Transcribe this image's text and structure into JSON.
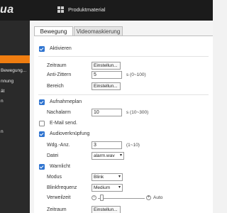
{
  "header": {
    "logo": "ua",
    "product_label": "Produktmaterial",
    "product_icon": "grid-icon"
  },
  "sidebar": {
    "items": [
      {
        "label": "",
        "active": true
      },
      {
        "label": "Bewegung...",
        "active": false
      },
      {
        "label": "nnung",
        "active": false
      },
      {
        "label": "ät",
        "active": false
      },
      {
        "label": "n",
        "active": false
      },
      {
        "label": "n",
        "active": false
      }
    ]
  },
  "tabs": [
    {
      "label": "Bewegung",
      "active": true
    },
    {
      "label": "Videomaskierung",
      "active": false
    }
  ],
  "form": {
    "aktivieren": {
      "label": "Aktivieren",
      "checked": true
    },
    "zeitraum1": {
      "label": "Zeitraum",
      "button": "Einstellun..."
    },
    "anti_zittern": {
      "label": "Anti-Zittern",
      "value": "5",
      "hint": "s (0~100)"
    },
    "bereich": {
      "label": "Bereich",
      "button": "Einstellun..."
    },
    "aufnahmeplan": {
      "label": "Aufnahmeplan",
      "checked": true
    },
    "nachalarm": {
      "label": "Nachalarm",
      "value": "10",
      "hint": "s (10~300)"
    },
    "email": {
      "label": "E-Mail send.",
      "checked": false
    },
    "audio": {
      "label": "Audioverknüpfung",
      "checked": true
    },
    "wdg": {
      "label": "Wdg.-Anz.",
      "value": "3",
      "hint": "(1~10)"
    },
    "datei": {
      "label": "Datei",
      "value": "alarm.wav"
    },
    "warnlicht": {
      "label": "Warnlicht",
      "checked": true
    },
    "modus": {
      "label": "Modus",
      "value": "Blink"
    },
    "blinkfrequenz": {
      "label": "Blinkfrequenz",
      "value": "Medium"
    },
    "verweilzeit": {
      "label": "Verweilzeit",
      "minus": "−",
      "plus": "+",
      "auto_label": "Auto",
      "level": 0.08
    },
    "zeitraum2": {
      "label": "Zeitraum",
      "button": "Einstellun..."
    }
  }
}
